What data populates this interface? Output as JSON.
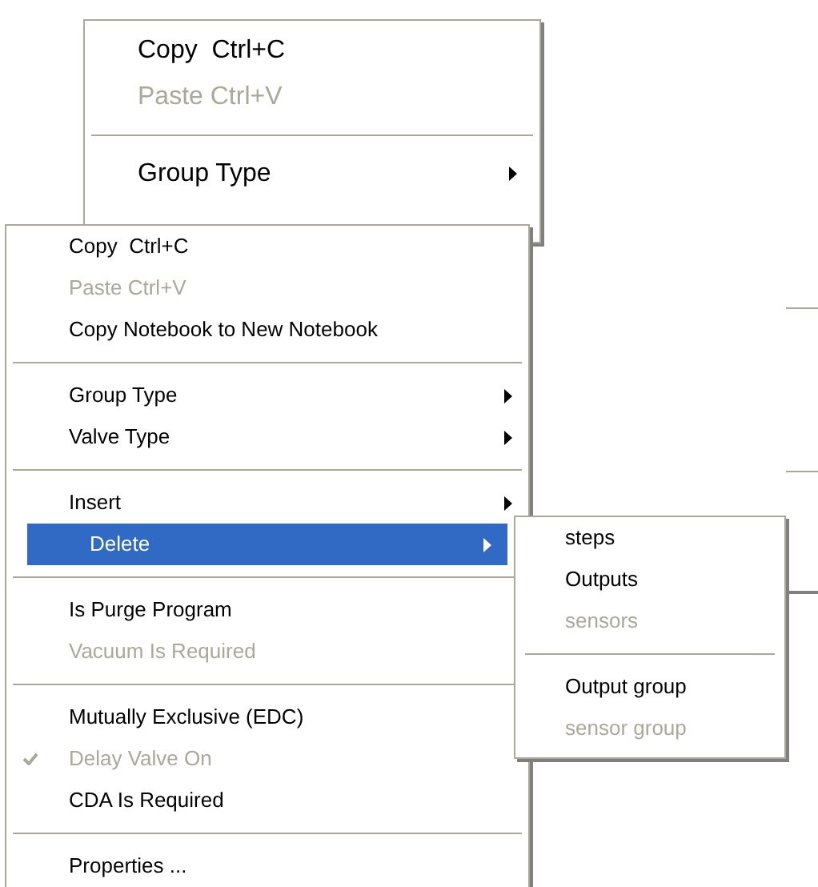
{
  "menus": [
    {
      "kind": "back",
      "items": [
        {
          "kind": "item",
          "label": "Copy  Ctrl+C",
          "disabled": false,
          "submenu": false
        },
        {
          "kind": "item",
          "label": "Paste Ctrl+V",
          "disabled": true,
          "submenu": false
        },
        {
          "kind": "separator"
        },
        {
          "kind": "item",
          "label": "Group Type",
          "disabled": false,
          "submenu": true
        }
      ]
    },
    {
      "kind": "main",
      "items": [
        {
          "kind": "item",
          "label": "Copy  Ctrl+C",
          "disabled": false,
          "submenu": false,
          "checked": false,
          "selected": false
        },
        {
          "kind": "item",
          "label": "Paste Ctrl+V",
          "disabled": true,
          "submenu": false,
          "checked": false,
          "selected": false
        },
        {
          "kind": "item",
          "label": "Copy Notebook to New Notebook",
          "disabled": false,
          "submenu": false,
          "checked": false,
          "selected": false
        },
        {
          "kind": "separator"
        },
        {
          "kind": "item",
          "label": "Group Type",
          "disabled": false,
          "submenu": true,
          "checked": false,
          "selected": false
        },
        {
          "kind": "item",
          "label": "Valve Type",
          "disabled": false,
          "submenu": true,
          "checked": false,
          "selected": false
        },
        {
          "kind": "separator"
        },
        {
          "kind": "item",
          "label": "Insert",
          "disabled": false,
          "submenu": true,
          "checked": false,
          "selected": false
        },
        {
          "kind": "item",
          "label": "Delete",
          "disabled": false,
          "submenu": true,
          "checked": false,
          "selected": true
        },
        {
          "kind": "separator"
        },
        {
          "kind": "item",
          "label": "Is Purge Program",
          "disabled": false,
          "submenu": false,
          "checked": false,
          "selected": false
        },
        {
          "kind": "item",
          "label": "Vacuum Is Required",
          "disabled": true,
          "submenu": false,
          "checked": false,
          "selected": false
        },
        {
          "kind": "separator"
        },
        {
          "kind": "item",
          "label": "Mutually Exclusive (EDC)",
          "disabled": false,
          "submenu": false,
          "checked": false,
          "selected": false
        },
        {
          "kind": "item",
          "label": "Delay Valve On",
          "disabled": true,
          "submenu": false,
          "checked": true,
          "selected": false
        },
        {
          "kind": "item",
          "label": "CDA Is Required",
          "disabled": false,
          "submenu": false,
          "checked": false,
          "selected": false
        },
        {
          "kind": "separator"
        },
        {
          "kind": "item",
          "label": "Properties ...",
          "disabled": false,
          "submenu": false,
          "checked": false,
          "selected": false
        }
      ]
    },
    {
      "kind": "sub",
      "items": [
        {
          "kind": "item",
          "label": "steps",
          "disabled": false,
          "submenu": false
        },
        {
          "kind": "item",
          "label": "Outputs",
          "disabled": false,
          "submenu": false
        },
        {
          "kind": "item",
          "label": "sensors",
          "disabled": true,
          "submenu": false
        },
        {
          "kind": "separator"
        },
        {
          "kind": "item",
          "label": "Output group",
          "disabled": false,
          "submenu": false
        },
        {
          "kind": "item",
          "label": "sensor group",
          "disabled": true,
          "submenu": false
        }
      ]
    }
  ]
}
